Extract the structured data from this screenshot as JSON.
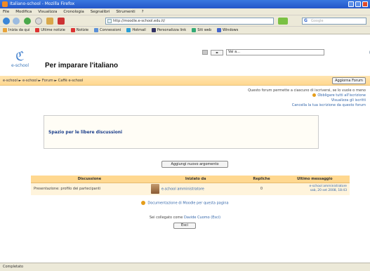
{
  "window": {
    "title": "Italiano-school - Mozilla Firefox"
  },
  "menubar": [
    "File",
    "Modifica",
    "Visualizza",
    "Cronologia",
    "Segnalibri",
    "Strumenti",
    "?"
  ],
  "address": {
    "url": "http://moodle.e-school.edu.it/"
  },
  "search": {
    "placeholder": "Google"
  },
  "bookmarks": [
    {
      "label": "Inizia da qui",
      "color": "#e8a33b"
    },
    {
      "label": "Ultime notizie",
      "color": "#d33"
    },
    {
      "label": "Notizie",
      "color": "#d33"
    },
    {
      "label": "Connessioni",
      "color": "#5a8fd8"
    },
    {
      "label": "Hotmail",
      "color": "#2a9fd8"
    },
    {
      "label": "Personalizza link",
      "color": "#336"
    },
    {
      "label": "Siti web",
      "color": "#3a7"
    },
    {
      "label": "Windows",
      "color": "#46c"
    }
  ],
  "site": {
    "logo_text": "e-school",
    "title": "Per imparare l'italiano"
  },
  "jump": {
    "select": "Vai a...",
    "search": "Vai a..."
  },
  "breadcrumb": [
    "e-school",
    "e-school",
    "Forum",
    "Caffè e-school"
  ],
  "buttons": {
    "update_forum": "Aggiorna Forum",
    "new_topic": "Aggiungi nuovo argomento",
    "logout": "Esci"
  },
  "sublinks": {
    "line1": "Questo forum permette a ciascuno di iscriversi, se lo vuole o meno",
    "line2": "Obbligare tutti all'iscrizione",
    "line3": "Visualizza gli iscritti",
    "line4": "Cancella la tua iscrizione da questo forum"
  },
  "intro": {
    "text": "Spazio per le libere discussioni"
  },
  "table": {
    "headers": [
      "Discussione",
      "Iniziato da",
      "Repliche",
      "Ultimo messaggio"
    ],
    "rows": [
      {
        "topic": "Presentazione: profilo dei partecipanti",
        "author": "e-school amministratore",
        "replies": "0",
        "last_author": "e-school amministratore",
        "last_date": "sab, 20 set 2008, 18:43"
      }
    ]
  },
  "footer": {
    "doc_link": "Documentazione di Moodle per questa pagina",
    "login_prefix": "Sei collegato come",
    "login_user": "Davide Cuomo (Esci)"
  },
  "status": {
    "text": "Completato"
  },
  "colors": {
    "accent": "#ffd890",
    "link": "#3366aa",
    "title_bar": "#2456c8"
  }
}
